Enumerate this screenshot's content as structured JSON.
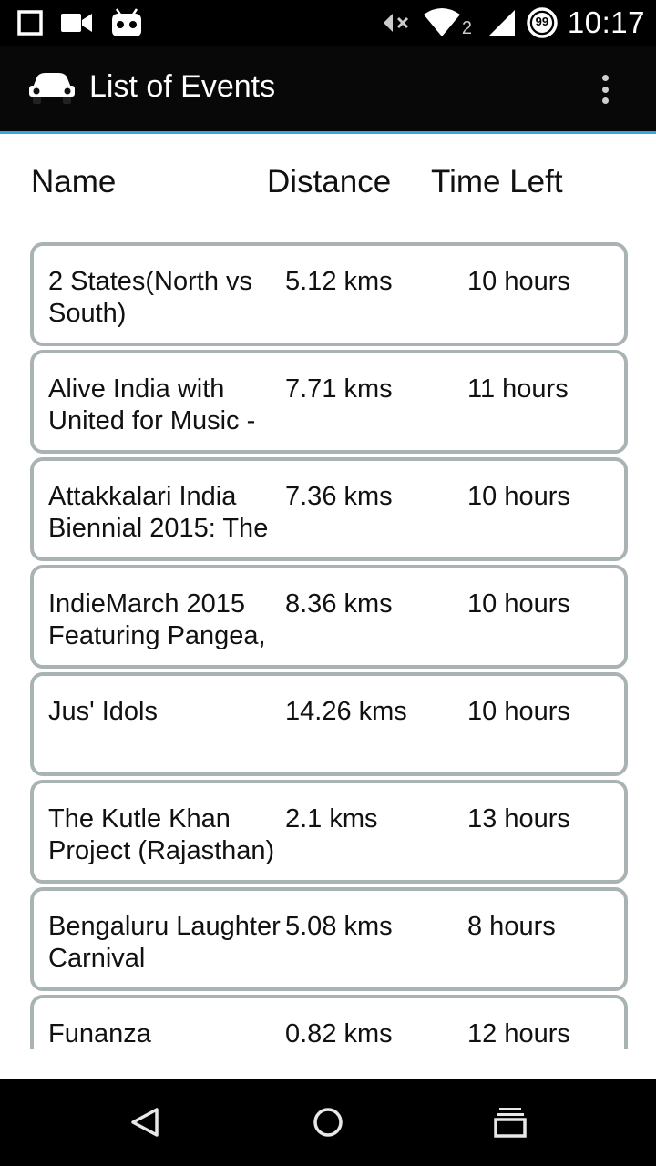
{
  "status_bar": {
    "time": "10:17",
    "signal_sub": "2",
    "battery_level": "99",
    "icons": [
      "square-notification-icon",
      "video-camera-icon",
      "android-bot-icon",
      "muted-volume-icon",
      "wifi-icon",
      "cell-signal-icon",
      "battery-circle-icon"
    ]
  },
  "app_bar": {
    "title": "List of Events",
    "icon": "car-icon",
    "menu_icon": "overflow-menu-icon"
  },
  "table": {
    "headers": {
      "name": "Name",
      "distance": "Distance",
      "time_left": "Time Left"
    },
    "rows": [
      {
        "name": "2 States(North vs South)",
        "distance": "5.12 kms",
        "time_left": "10 hours"
      },
      {
        "name": "Alive India with United for Music -",
        "distance": "7.71 kms",
        "time_left": "11 hours"
      },
      {
        "name": "Attakkalari India Biennial 2015: The",
        "distance": "7.36 kms",
        "time_left": "10 hours"
      },
      {
        "name": "IndieMarch 2015 Featuring Pangea,",
        "distance": "8.36 kms",
        "time_left": "10 hours"
      },
      {
        "name": "Jus' Idols",
        "distance": "14.26 kms",
        "time_left": "10 hours"
      },
      {
        "name": "The Kutle Khan Project (Rajasthan)",
        "distance": "2.1 kms",
        "time_left": "13 hours"
      },
      {
        "name": "Bengaluru Laughter Carnival",
        "distance": "5.08 kms",
        "time_left": "8 hours"
      },
      {
        "name": "Funanza",
        "distance": "0.82 kms",
        "time_left": "12 hours"
      }
    ]
  },
  "nav_bar": {
    "buttons": [
      "back-icon",
      "home-icon",
      "recents-icon"
    ]
  }
}
